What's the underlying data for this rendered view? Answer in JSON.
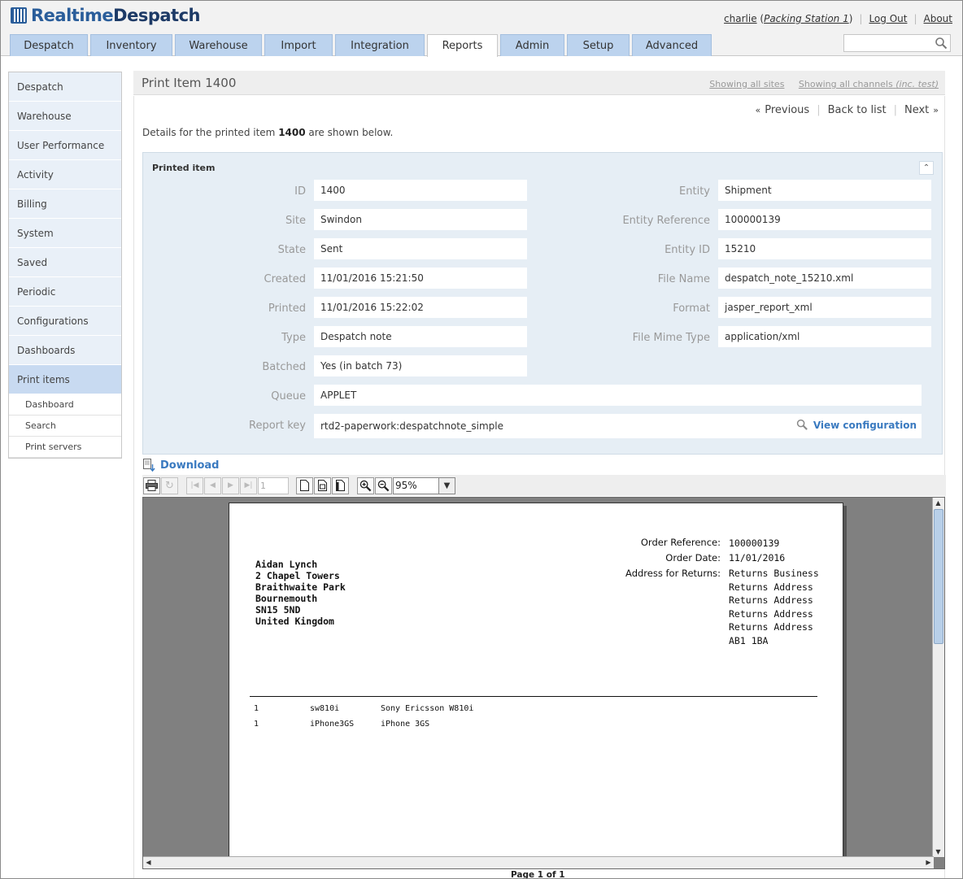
{
  "app": {
    "logo_part1": "Realtime",
    "logo_part2": "Despatch"
  },
  "user": {
    "name": "charlie",
    "station": "Packing Station 1",
    "logout": "Log Out",
    "about": "About"
  },
  "tabs": [
    "Despatch",
    "Inventory",
    "Warehouse",
    "Import",
    "Integration",
    "Reports",
    "Admin",
    "Setup",
    "Advanced"
  ],
  "active_tab": "Reports",
  "search": {
    "placeholder": ""
  },
  "sidebar": {
    "items": [
      "Despatch",
      "Warehouse",
      "User Performance",
      "Activity",
      "Billing",
      "System",
      "Saved",
      "Periodic",
      "Configurations",
      "Dashboards",
      "Print items"
    ],
    "active": "Print items",
    "subitems": [
      "Dashboard",
      "Search",
      "Print servers"
    ]
  },
  "page": {
    "title": "Print Item 1400",
    "showing_sites": "Showing all sites",
    "showing_channels": "Showing all channels",
    "showing_channels_suffix": "(inc. test)",
    "previous": "Previous",
    "back": "Back to list",
    "next": "Next",
    "intro_pre": "Details for the printed item ",
    "intro_id": "1400",
    "intro_post": " are shown below."
  },
  "panel": {
    "title": "Printed item",
    "left": [
      {
        "label": "ID",
        "value": "1400"
      },
      {
        "label": "Site",
        "value": "Swindon"
      },
      {
        "label": "State",
        "value": "Sent"
      },
      {
        "label": "Created",
        "value": "11/01/2016 15:21:50"
      },
      {
        "label": "Printed",
        "value": "11/01/2016 15:22:02"
      },
      {
        "label": "Type",
        "value": "Despatch note"
      },
      {
        "label": "Batched",
        "value": "Yes (in batch 73)"
      }
    ],
    "right": [
      {
        "label": "Entity",
        "value": "Shipment"
      },
      {
        "label": "Entity Reference",
        "value": "100000139"
      },
      {
        "label": "Entity ID",
        "value": "15210"
      },
      {
        "label": "File Name",
        "value": "despatch_note_15210.xml"
      },
      {
        "label": "Format",
        "value": "jasper_report_xml"
      },
      {
        "label": "File Mime Type",
        "value": "application/xml"
      }
    ],
    "queue": {
      "label": "Queue",
      "value": "APPLET"
    },
    "report_key": {
      "label": "Report key",
      "value": "rtd2-paperwork:despatchnote_simple"
    },
    "view_configuration": "View configuration"
  },
  "download": "Download",
  "viewer": {
    "page_input": "1",
    "zoom": "95%",
    "status": "Page 1 of 1"
  },
  "document": {
    "address": [
      "Aidan Lynch",
      "2 Chapel Towers",
      "Braithwaite Park",
      "Bournemouth",
      "SN15 5ND",
      "United Kingdom"
    ],
    "order_reference_label": "Order Reference:",
    "order_reference": "100000139",
    "order_date_label": "Order Date:",
    "order_date": "11/01/2016",
    "returns_label": "Address for Returns:",
    "returns_address": [
      "Returns Business",
      "Returns Address",
      "Returns Address",
      "Returns Address",
      "Returns Address",
      "AB1 1BA"
    ],
    "lines": [
      {
        "qty": "1",
        "sku": "sw810i",
        "description": "Sony Ericsson W810i"
      },
      {
        "qty": "1",
        "sku": "iPhone3GS",
        "description": "iPhone 3GS"
      }
    ]
  }
}
